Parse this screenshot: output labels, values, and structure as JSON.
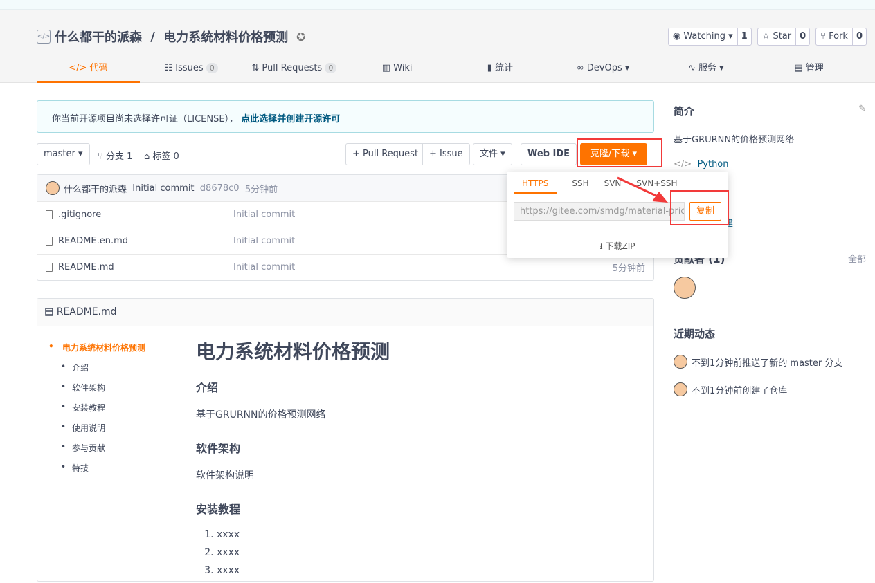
{
  "repo": {
    "owner": "什么都干的派森",
    "name": "电力系统材料价格预测",
    "separator": " / "
  },
  "actions": [
    {
      "label": "Watching ▾",
      "count": "1",
      "icon": "eye-icon"
    },
    {
      "label": "Star",
      "count": "0",
      "icon": "star-icon"
    },
    {
      "label": "Fork",
      "count": "0",
      "icon": "fork-icon"
    }
  ],
  "tabs": [
    {
      "label": "代码",
      "icon": "code-icon"
    },
    {
      "label": "Issues",
      "count": "0"
    },
    {
      "label": "Pull Requests",
      "count": "0"
    },
    {
      "label": "Wiki"
    },
    {
      "label": "统计"
    },
    {
      "label": "DevOps ▾"
    },
    {
      "label": "服务 ▾"
    },
    {
      "label": "管理"
    }
  ],
  "notice": {
    "text": "你当前开源项目尚未选择许可证（LICENSE），",
    "link": "点此选择并创建开源许可"
  },
  "toolbar": {
    "branch": "master ▾",
    "branches": "分支 1",
    "tags": "标签 0",
    "pull_request": "+ Pull Request",
    "issue": "+ Issue",
    "file": "文件 ▾",
    "webide": "Web IDE",
    "clone": "克隆/下载"
  },
  "commit": {
    "author": "什么都干的派森",
    "message": "Initial commit",
    "hash": "d8678c0",
    "time": "5分钟前"
  },
  "files": [
    {
      "name": ".gitignore",
      "msg": "Initial commit",
      "time": ""
    },
    {
      "name": "README.en.md",
      "msg": "Initial commit",
      "time": ""
    },
    {
      "name": "README.md",
      "msg": "Initial commit",
      "time": "5分钟前"
    }
  ],
  "readme": {
    "file": "README.md",
    "toc": [
      "电力系统材料价格预测",
      "介绍",
      "软件架构",
      "安装教程",
      "使用说明",
      "参与贡献",
      "特技"
    ],
    "h1": "电力系统材料价格预测",
    "s1": "介绍",
    "p1": "基于GRURNN的价格预测网络",
    "s2": "软件架构",
    "p2": "软件架构说明",
    "s3": "安装教程",
    "list": [
      "xxxx",
      "xxxx",
      "xxxx"
    ]
  },
  "sidebar": {
    "intro_title": "简介",
    "desc": "基于GRURNN的价格预测网络",
    "lang": "Python",
    "created": "创建",
    "contrib": "贡献者 (1)",
    "all": "全部",
    "activity_title": "近期动态",
    "activity": [
      "不到1分钟前推送了新的 master 分支",
      "不到1分钟前创建了仓库"
    ]
  },
  "clone": {
    "tabs": [
      "HTTPS",
      "SSH",
      "SVN",
      "SVN+SSH"
    ],
    "url": "https://gitee.com/smdg/material-price",
    "copy": "复制",
    "zip": "下载ZIP"
  },
  "colors": {
    "accent": "#fe7300",
    "annotation": "#f23a3a"
  }
}
